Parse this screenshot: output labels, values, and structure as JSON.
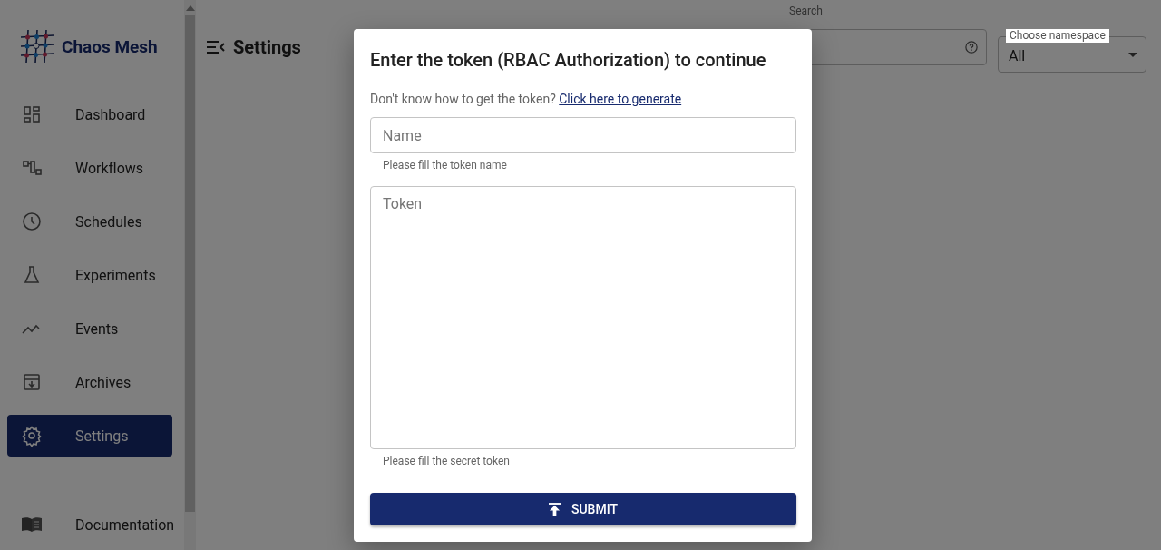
{
  "sidebar": {
    "brand": "Chaos Mesh",
    "items": [
      {
        "label": "Dashboard",
        "kind": "dashboard",
        "selected": false
      },
      {
        "label": "Workflows",
        "kind": "workflows",
        "selected": false
      },
      {
        "label": "Schedules",
        "kind": "schedules",
        "selected": false
      },
      {
        "label": "Experiments",
        "kind": "experiments",
        "selected": false
      },
      {
        "label": "Events",
        "kind": "events",
        "selected": false
      },
      {
        "label": "Archives",
        "kind": "archives",
        "selected": false
      },
      {
        "label": "Settings",
        "kind": "settings",
        "selected": true
      }
    ],
    "footer_items": [
      {
        "label": "Documentation",
        "kind": "documentation"
      }
    ]
  },
  "header": {
    "title": "Settings"
  },
  "search": {
    "label": "Search"
  },
  "namespace": {
    "label": "Choose namespace",
    "value": "All"
  },
  "dialog": {
    "title": "Enter the token (RBAC Authorization) to continue",
    "help_text": "Don't know how to get the token?",
    "help_link": "Click here to generate",
    "fields": [
      {
        "placeholder": "Name",
        "helper": "Please fill the token name",
        "kind": "input"
      },
      {
        "placeholder": "Token",
        "helper": "Please fill the secret token",
        "kind": "textarea"
      }
    ],
    "submit": "SUBMIT"
  }
}
